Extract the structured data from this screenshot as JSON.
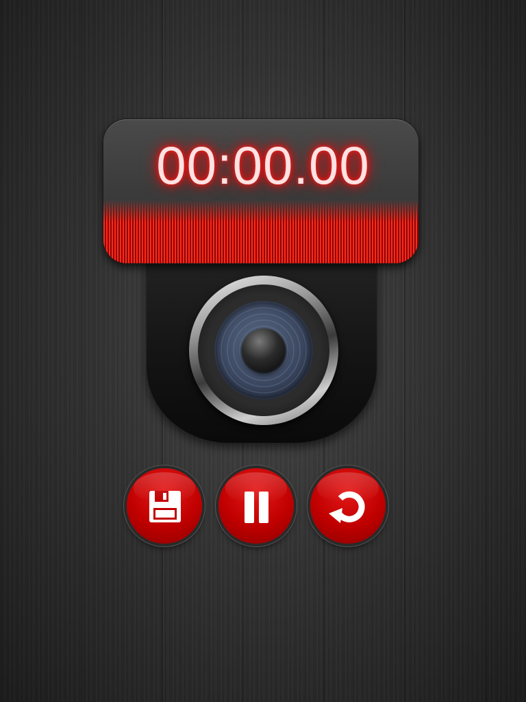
{
  "timer": {
    "display": "00:00.00"
  },
  "controls": [
    {
      "name": "save",
      "icon": "floppy-disk-icon"
    },
    {
      "name": "pause",
      "icon": "pause-icon"
    },
    {
      "name": "reset",
      "icon": "refresh-icon"
    }
  ],
  "colors": {
    "accent": "#c00000",
    "timer_glow": "#ff0000",
    "background": "#333333"
  }
}
